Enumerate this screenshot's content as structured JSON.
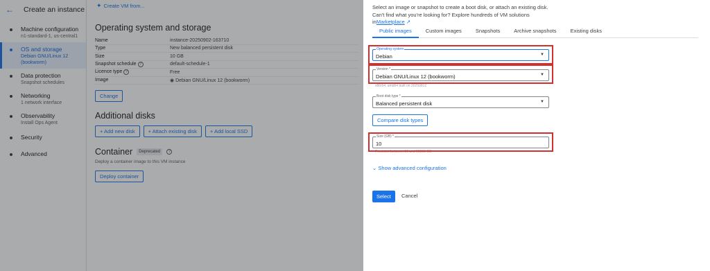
{
  "sidebar": {
    "title": "Create an instance",
    "items": [
      {
        "label": "Machine configuration",
        "sub": "n1-standard-1, us-central1"
      },
      {
        "label": "OS and storage",
        "sub": "Debian GNU/Linux 12",
        "sub2": "(bookworm)"
      },
      {
        "label": "Data protection",
        "sub": "Snapshot schedules"
      },
      {
        "label": "Networking",
        "sub": "1 network interface"
      },
      {
        "label": "Observability",
        "sub": "Install Ops Agent"
      },
      {
        "label": "Security",
        "sub": ""
      },
      {
        "label": "Advanced",
        "sub": ""
      }
    ]
  },
  "toolbar": {
    "create_vm": "Create VM from..."
  },
  "os_storage": {
    "title": "Operating system and storage",
    "rows": [
      {
        "k": "Name",
        "v": "instance-20250902-163710"
      },
      {
        "k": "Type",
        "v": "New balanced persistent disk"
      },
      {
        "k": "Size",
        "v": "10 GB"
      },
      {
        "k": "Snapshot schedule",
        "v": "default-schedule-1"
      },
      {
        "k": "Licence type",
        "v": "Free"
      },
      {
        "k": "Image",
        "v": "Debian GNU/Linux 12 (bookworm)"
      }
    ],
    "change_label": "Change"
  },
  "additional_disks": {
    "title": "Additional disks",
    "add_new": "+ Add new disk",
    "attach": "+ Attach existing disk",
    "add_ssd": "+ Add local SSD"
  },
  "container": {
    "title": "Container",
    "badge": "Deprecated",
    "desc": "Deploy a container image to this VM instance",
    "deploy": "Deploy container"
  },
  "panel": {
    "intro": "Select an image or snapshot to create a boot disk, or attach an existing disk. Can't find what you're looking for? Explore hundreds of VM solutions in",
    "marketplace": "Marketplace",
    "tabs": [
      "Public images",
      "Custom images",
      "Snapshots",
      "Archive snapshots",
      "Existing disks"
    ],
    "os_label": "Operating system",
    "os_value": "Debian",
    "version_label": "Version *",
    "version_value": "Debian GNU/Linux 12 (bookworm)",
    "version_hint": "x86/64, amd64 built on 20250812",
    "disk_type_label": "Boot disk type *",
    "disk_type_value": "Balanced persistent disk",
    "compare": "Compare disk types",
    "size_label": "Size (GB) *",
    "size_value": "10",
    "size_hint": "Provision between 10 and 65536 GB",
    "advanced": "Show advanced configuration",
    "select": "Select",
    "cancel": "Cancel"
  },
  "colors": {
    "accent": "#1a73e8",
    "highlight": "#d32f2f"
  }
}
